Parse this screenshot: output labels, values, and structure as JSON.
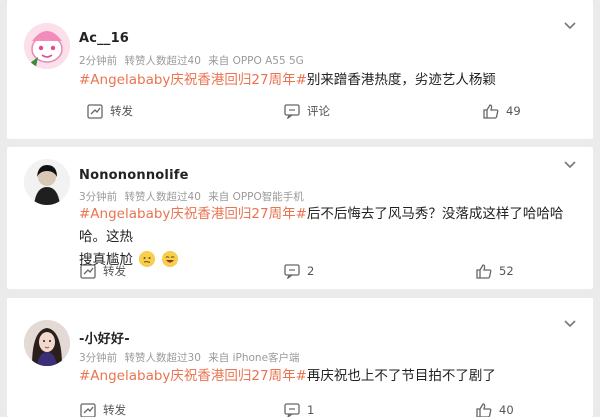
{
  "posts": [
    {
      "username": "Ac__16",
      "time": "2分钟前",
      "reposts_note": "转赞人数超过40",
      "source": "来自 OPPO A55 5G",
      "topic": "#Angelababy庆祝香港回归27周年#",
      "text": "别来蹭香港热度，劣迹艺人杨颖",
      "repost_label": "转发",
      "comment_label": "评论",
      "like_count": "49"
    },
    {
      "username": "Nonononnolife",
      "time": "3分钟前",
      "reposts_note": "转赞人数超过40",
      "source": "来自 OPPO智能手机",
      "topic": "#Angelababy庆祝香港回归27周年#",
      "text_line1": "后不后悔去了风马秀？没落成这样了哈哈哈哈。这热",
      "text_line2": "搜真尴尬",
      "repost_label": "转发",
      "comment_count": "2",
      "like_count": "52"
    },
    {
      "username": "-小好好-",
      "time": "3分钟前",
      "reposts_note": "转赞人数超过30",
      "source": "来自 iPhone客户端",
      "topic": "#Angelababy庆祝香港回归27周年#",
      "text": "再庆祝也上不了节目拍不了剧了",
      "repost_label": "转发",
      "comment_count": "1",
      "like_count": "40"
    }
  ],
  "icons": {
    "more": "chevron-down-icon",
    "repost": "repost-icon",
    "comment": "comment-icon",
    "like": "like-icon"
  },
  "colors": {
    "topic": "#eb7350",
    "meta": "#9a9a9a",
    "background": "#ebebeb"
  }
}
